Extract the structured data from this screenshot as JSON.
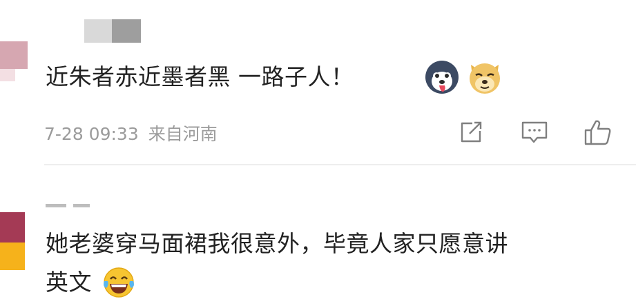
{
  "comment1": {
    "text": "近朱者赤近墨者黑 一路子人！",
    "timestamp": "7-28 09:33",
    "location": "来自河南",
    "emojis": [
      "husky-emoji",
      "doge-emoji"
    ]
  },
  "comment1_actions": [
    "share-icon",
    "comment-icon",
    "like-icon"
  ],
  "comment2": {
    "line1": "她老婆穿马面裙我很意外，毕竟人家只愿意讲",
    "line2": "英文",
    "emojis": [
      "laughing-tears-emoji"
    ]
  },
  "colors": {
    "text": "#222222",
    "meta": "#9b9b9b",
    "divider": "#eeeeee",
    "icon": "#7f7f7f"
  }
}
